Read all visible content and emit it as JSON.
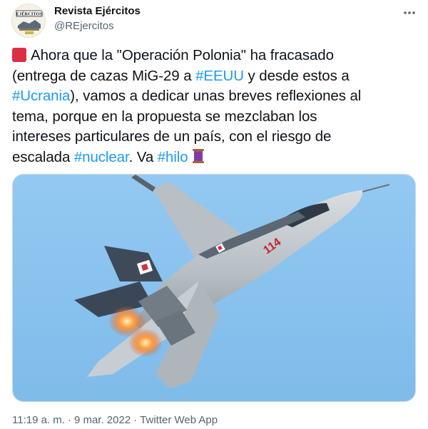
{
  "author": {
    "display_name": "Revista Ejércitos",
    "handle": "@REjercitos",
    "avatar_label": "EJÉRCITOS"
  },
  "tweet": {
    "lines": [
      {
        "segments": [
          {
            "text": "Ahora que la \"Operación Polonia\" ha fracasado",
            "hashtag": false
          }
        ]
      },
      {
        "segments": [
          {
            "text": "(entrega de cazas MiG-29 a ",
            "hashtag": false
          },
          {
            "text": "#EEUU",
            "hashtag": true
          },
          {
            "text": " y desde estos a",
            "hashtag": false
          }
        ]
      },
      {
        "segments": [
          {
            "text": "#Ucrania",
            "hashtag": true
          },
          {
            "text": "), vamos a dedicar unas breves reflexiones al",
            "hashtag": false
          }
        ]
      },
      {
        "segments": [
          {
            "text": "tema, porque en la propuesta se mezclaban los",
            "hashtag": false
          }
        ]
      },
      {
        "segments": [
          {
            "text": "intereses particulares de un país, con el riesgo de",
            "hashtag": false
          }
        ]
      },
      {
        "segments": [
          {
            "text": "escalada ",
            "hashtag": false
          },
          {
            "text": "#nuclear",
            "hashtag": true
          },
          {
            "text": ". Va ",
            "hashtag": false
          },
          {
            "text": "#hilo",
            "hashtag": true
          }
        ]
      }
    ],
    "leading_emoji": "red-square-icon",
    "trailing_emoji": "thread-spool-icon"
  },
  "media": {
    "aircraft_number": "114",
    "sky_color": "#8ec5ef"
  },
  "meta": {
    "time": "11:19 a. m.",
    "date": "9 mar. 2022",
    "source": "Twitter Web App",
    "separator": "·"
  },
  "colors": {
    "link": "#1d9bf0",
    "secondary_text": "#536471"
  }
}
